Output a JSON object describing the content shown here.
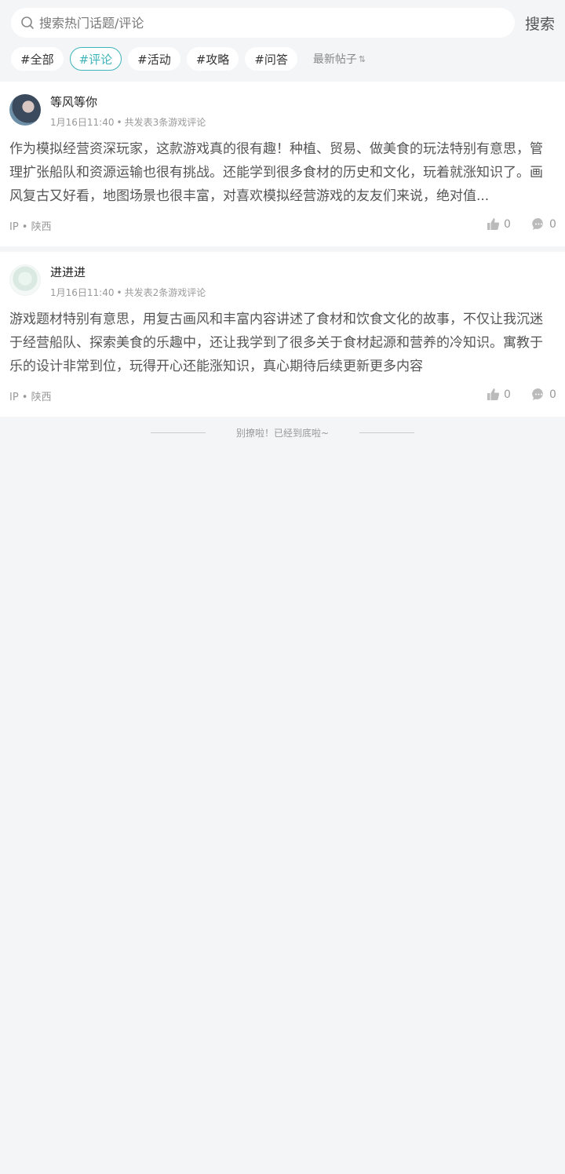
{
  "search": {
    "placeholder": "搜索热门话题/评论",
    "button_label": "搜索"
  },
  "tabs": [
    {
      "label": "#全部",
      "active": false
    },
    {
      "label": "#评论",
      "active": true
    },
    {
      "label": "#活动",
      "active": false
    },
    {
      "label": "#攻略",
      "active": false
    },
    {
      "label": "#问答",
      "active": false
    }
  ],
  "sort": {
    "label": "最新帖子",
    "icon": "sort-arrows-icon"
  },
  "colors": {
    "accent": "#3fb4b8",
    "background": "#f3f5f7"
  },
  "posts": [
    {
      "username": "等风等你",
      "time": "1月16日11:40",
      "stat": "共发表3条游戏评论",
      "content": "作为模拟经营资深玩家，这款游戏真的很有趣！种植、贸易、做美食的玩法特别有意思，管理扩张船队和资源运输也很有挑战。还能学到很多食材的历史和文化，玩着就涨知识了。画风复古又好看，地图场景也很丰富，对喜欢模拟经营游戏的友友们来说，绝对值...",
      "ip": "IP • 陕西",
      "likes": "0",
      "comments": "0"
    },
    {
      "username": "进进进",
      "time": "1月16日11:40",
      "stat": "共发表2条游戏评论",
      "content": "游戏题材特别有意思，用复古画风和丰富内容讲述了食材和饮食文化的故事，不仅让我沉迷于经营船队、探索美食的乐趣中，还让我学到了很多关于食材起源和营养的冷知识。寓教于乐的设计非常到位，玩得开心还能涨知识，真心期待后续更新更多内容",
      "ip": "IP • 陕西",
      "likes": "0",
      "comments": "0"
    }
  ],
  "end_text": "别撩啦！已经到底啦~"
}
